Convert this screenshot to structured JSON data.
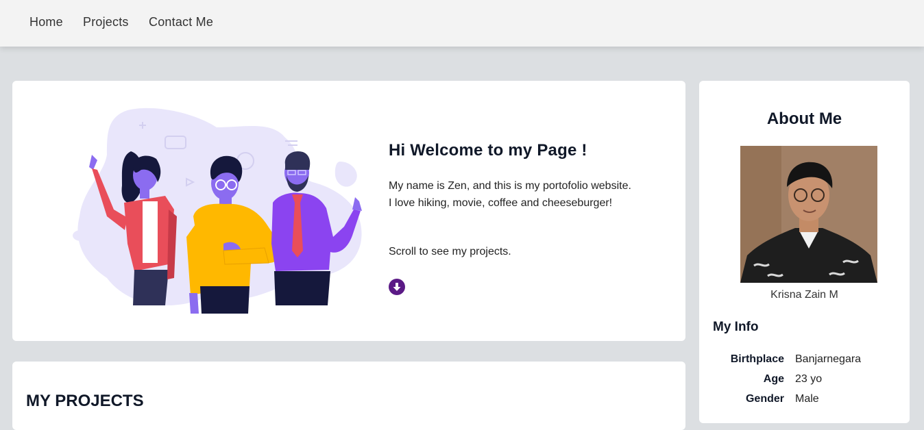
{
  "nav": {
    "items": [
      {
        "label": "Home"
      },
      {
        "label": "Projects"
      },
      {
        "label": "Contact Me"
      }
    ]
  },
  "hero": {
    "title": "Hi Welcome to my Page !",
    "intro_line1": "My name is Zen, and this is my portofolio website.",
    "intro_line2": "I love hiking, movie, coffee and cheeseburger!",
    "scroll_text": "Scroll to see my projects.",
    "scroll_icon": "arrow-down-circle-icon"
  },
  "about": {
    "title": "About Me",
    "photo_name": "Krisna Zain M",
    "info_title": "My Info",
    "info": [
      {
        "key": "Birthplace",
        "value": "Banjarnegara"
      },
      {
        "key": "Age",
        "value": "23 yo"
      },
      {
        "key": "Gender",
        "value": "Male"
      }
    ]
  },
  "projects": {
    "title": "MY PROJECTS"
  },
  "colors": {
    "accent": "#5b1a86",
    "background": "#dcdfe2",
    "navbar": "#f3f3f3"
  }
}
